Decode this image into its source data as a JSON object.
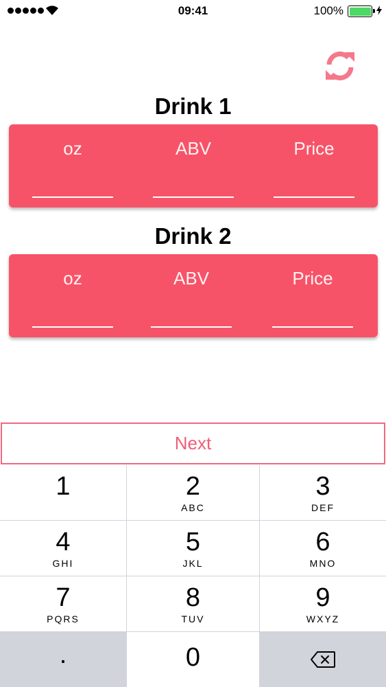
{
  "status_bar": {
    "time": "09:41",
    "battery_percent": "100%",
    "battery_color": "#4cd964"
  },
  "refresh": {
    "icon": "refresh-icon",
    "color": "#f4798a"
  },
  "drinks": [
    {
      "title": "Drink 1",
      "fields": [
        {
          "label": "oz"
        },
        {
          "label": "ABV"
        },
        {
          "label": "Price"
        }
      ]
    },
    {
      "title": "Drink 2",
      "fields": [
        {
          "label": "oz"
        },
        {
          "label": "ABV"
        },
        {
          "label": "Price"
        }
      ]
    }
  ],
  "card_color": "#f75368",
  "next_button": {
    "label": "Next"
  },
  "keypad": {
    "keys": [
      {
        "num": "1",
        "letters": ""
      },
      {
        "num": "2",
        "letters": "ABC"
      },
      {
        "num": "3",
        "letters": "DEF"
      },
      {
        "num": "4",
        "letters": "GHI"
      },
      {
        "num": "5",
        "letters": "JKL"
      },
      {
        "num": "6",
        "letters": "MNO"
      },
      {
        "num": "7",
        "letters": "PQRS"
      },
      {
        "num": "8",
        "letters": "TUV"
      },
      {
        "num": "9",
        "letters": "WXYZ"
      },
      {
        "num": ".",
        "letters": ""
      },
      {
        "num": "0",
        "letters": ""
      }
    ],
    "backspace_icon": "backspace-icon"
  }
}
